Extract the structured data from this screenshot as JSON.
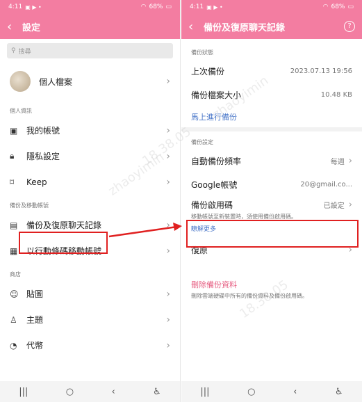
{
  "left": {
    "status_time": "4:11",
    "status_right": "68%",
    "title": "設定",
    "search_placeholder": "搜尋",
    "profile_label": "個人檔案",
    "section_personal": "個人資訊",
    "items_personal": [
      "我的帳號",
      "隱私設定",
      "Keep"
    ],
    "section_backup": "備份及移動帳號",
    "items_backup": [
      "備份及復原聊天記錄",
      "以行動條碼移動帳號"
    ],
    "section_store": "商店",
    "items_store": [
      "貼圖",
      "主題",
      "代幣"
    ]
  },
  "right": {
    "status_time": "4:11",
    "status_right": "68%",
    "title": "備份及復原聊天記錄",
    "section_status": "備份狀態",
    "last_backup_label": "上次備份",
    "last_backup_value": "2023.07.13 19:56",
    "size_label": "備份檔案大小",
    "size_value": "10.48 KB",
    "backup_now": "馬上進行備份",
    "section_settings": "備份設定",
    "auto_freq_label": "自動備份頻率",
    "auto_freq_value": "每週",
    "google_label": "Google帳號",
    "google_value": "20@gmail.co...",
    "pin_label": "備份啟用碼",
    "pin_value": "已設定",
    "pin_note": "移動帳號至新裝置時，須使用備份啟用碼。",
    "learn_more": "瞭解更多",
    "restore_label": "復原",
    "delete_label": "刪除備份資料",
    "delete_note": "刪除雲端硬碟中所有的備份資料及備份啟用碼。"
  },
  "watermarks": [
    "zhaoyimin",
    "18.38.05"
  ]
}
